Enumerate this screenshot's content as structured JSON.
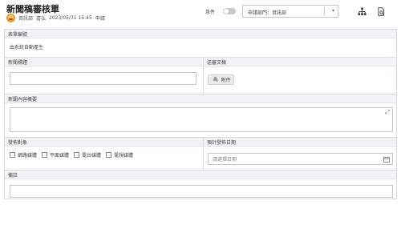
{
  "header": {
    "title": "新聞稿審核單",
    "department": "資訊部",
    "user": "喜弘",
    "datetime": "2023/05/31 15:45",
    "status": "申請",
    "urgent_label": "急件",
    "dept_select_value": "申請部門：資訊部",
    "tool_icons": [
      "org-chart-icon",
      "document-search-icon"
    ]
  },
  "form": {
    "form_number_label": "表單編號",
    "form_number_value": "由系統自動產生",
    "news_title_label": "新聞標題",
    "news_title_value": "",
    "attachments_label": "送審文稿",
    "attach_button_label": "附件",
    "content_label": "新聞內容概要",
    "audience_label": "發佈對象",
    "audience_options": [
      "網路媒體",
      "平面媒體",
      "電台媒體",
      "電視媒體"
    ],
    "release_date_label": "預計發佈日期",
    "release_date_placeholder": "請選擇日期",
    "remarks_label": "備註",
    "remarks_value": ""
  }
}
